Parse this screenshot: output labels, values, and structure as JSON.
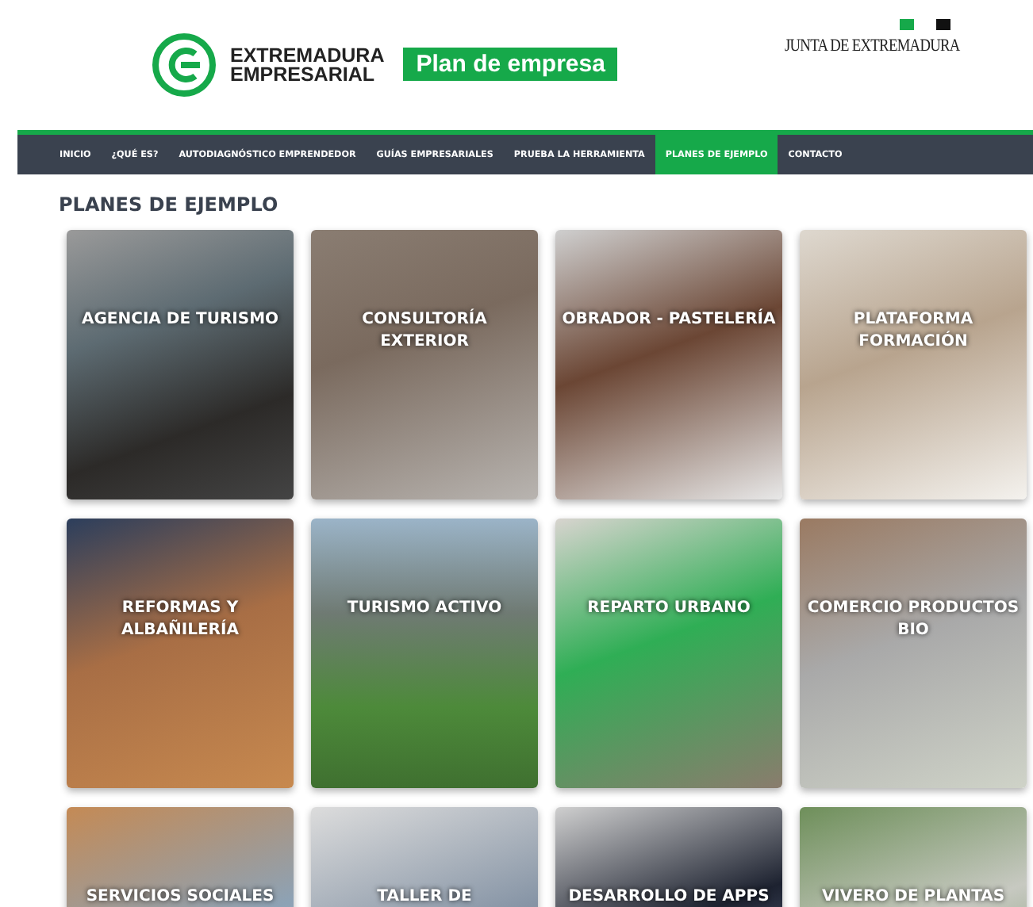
{
  "header": {
    "brand_line_1": "EXTREMADURA",
    "brand_line_2": "EMPRESARIAL",
    "badge": "Plan de empresa",
    "institution": "JUNTA DE EXTREMADURA"
  },
  "nav": [
    {
      "label": "INICIO",
      "selected": false
    },
    {
      "label": "¿QUÉ ES?",
      "selected": false
    },
    {
      "label": "AUTODIAGNÓSTICO EMPRENDEDOR",
      "selected": false
    },
    {
      "label": "GUÍAS EMPRESARIALES",
      "selected": false
    },
    {
      "label": "PRUEBA LA HERRAMIENTA",
      "selected": false
    },
    {
      "label": "PLANES DE EJEMPLO",
      "selected": true
    },
    {
      "label": "CONTACTO",
      "selected": false
    }
  ],
  "page_title": "PLANES DE EJEMPLO",
  "plans": [
    {
      "title": "AGENCIA DE TURISMO"
    },
    {
      "title": "CONSULTORÍA EXTERIOR"
    },
    {
      "title": "OBRADOR - PASTELERÍA"
    },
    {
      "title": "PLATAFORMA FORMACIÓN"
    },
    {
      "title": "REFORMAS Y ALBAÑILERÍA"
    },
    {
      "title": "TURISMO ACTIVO"
    },
    {
      "title": "REPARTO URBANO"
    },
    {
      "title": "COMERCIO PRODUCTOS BIO"
    },
    {
      "title": "SERVICIOS SOCIALES"
    },
    {
      "title": "TALLER DE"
    },
    {
      "title": "DESARROLLO DE APPS"
    },
    {
      "title": "VIVERO DE PLANTAS"
    }
  ]
}
